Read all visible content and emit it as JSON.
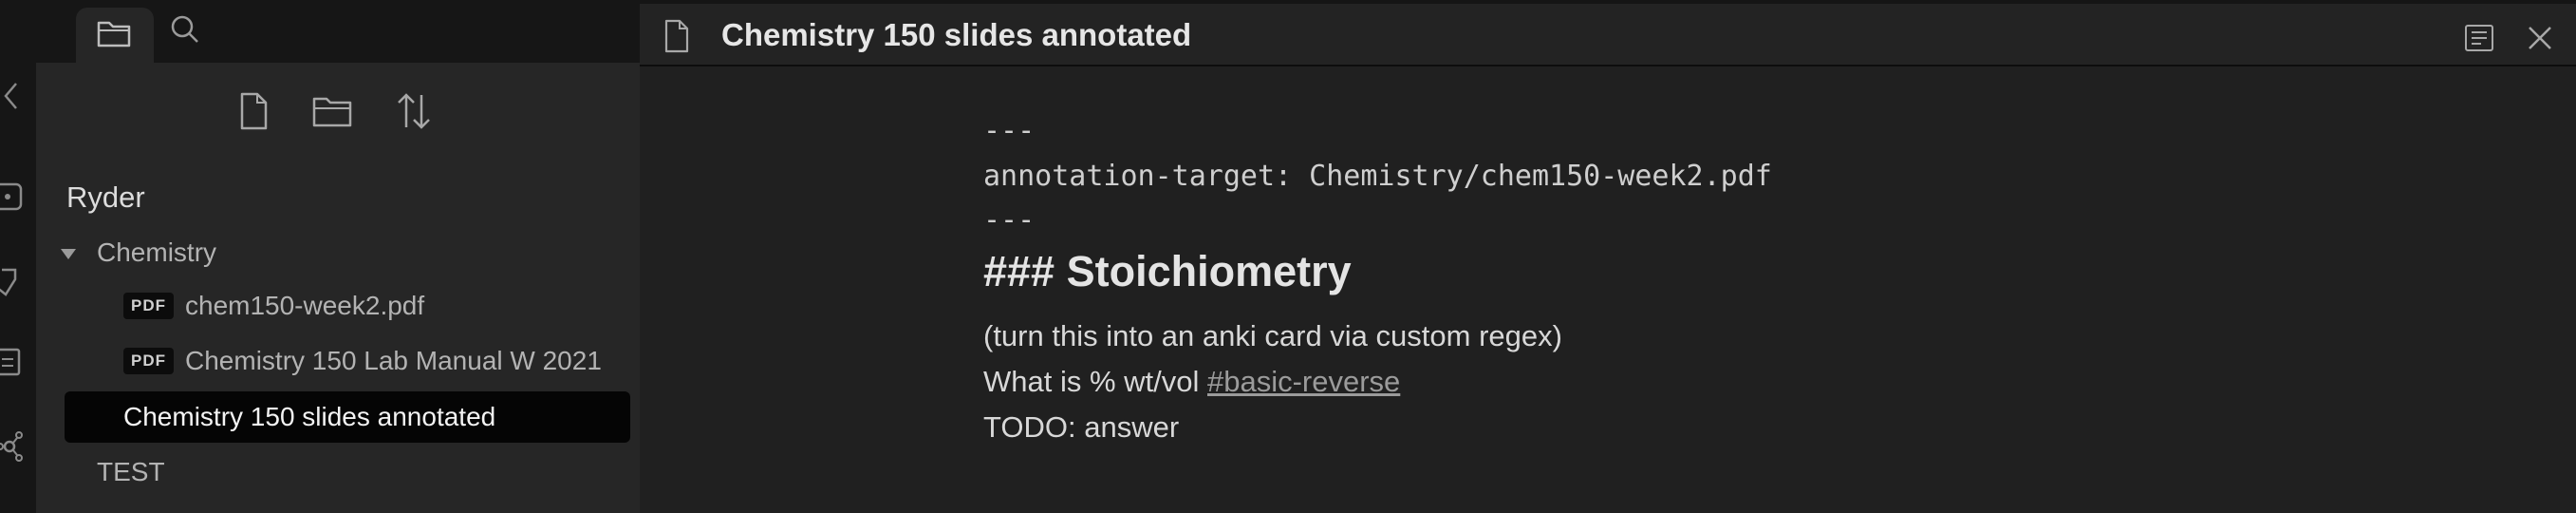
{
  "ribbon": {
    "icons": [
      "collapse-chevron-icon",
      "dice-icon",
      "tag-icon",
      "slides-icon",
      "graph-icon"
    ]
  },
  "sidebar": {
    "tabs": [
      "folder-icon",
      "search-icon"
    ],
    "actions": [
      "new-note-icon",
      "new-folder-icon",
      "sort-icon"
    ],
    "vault_name": "Ryder",
    "tree": {
      "folder": "Chemistry",
      "files": [
        {
          "badge": "PDF",
          "name": "chem150-week2.pdf"
        },
        {
          "badge": "PDF",
          "name": "Chemistry 150 Lab Manual W 2021"
        }
      ],
      "active_note": "Chemistry 150 slides annotated",
      "other": "TEST"
    }
  },
  "editor": {
    "title": "Chemistry 150 slides annotated",
    "frontmatter": {
      "open": "---",
      "line": "annotation-target: Chemistry/chem150-week2.pdf",
      "close": "---"
    },
    "heading": "### Stoichiometry",
    "lines": {
      "l1": "(turn this into an anki card via custom regex)",
      "l2_text": "What is % wt/vol ",
      "l2_tag": "#basic-reverse",
      "l3": "TODO: answer"
    }
  },
  "colors": {
    "background": "#202020",
    "sidebar": "#262626",
    "active_item": "#050505",
    "tag": "#9b9b9b"
  }
}
